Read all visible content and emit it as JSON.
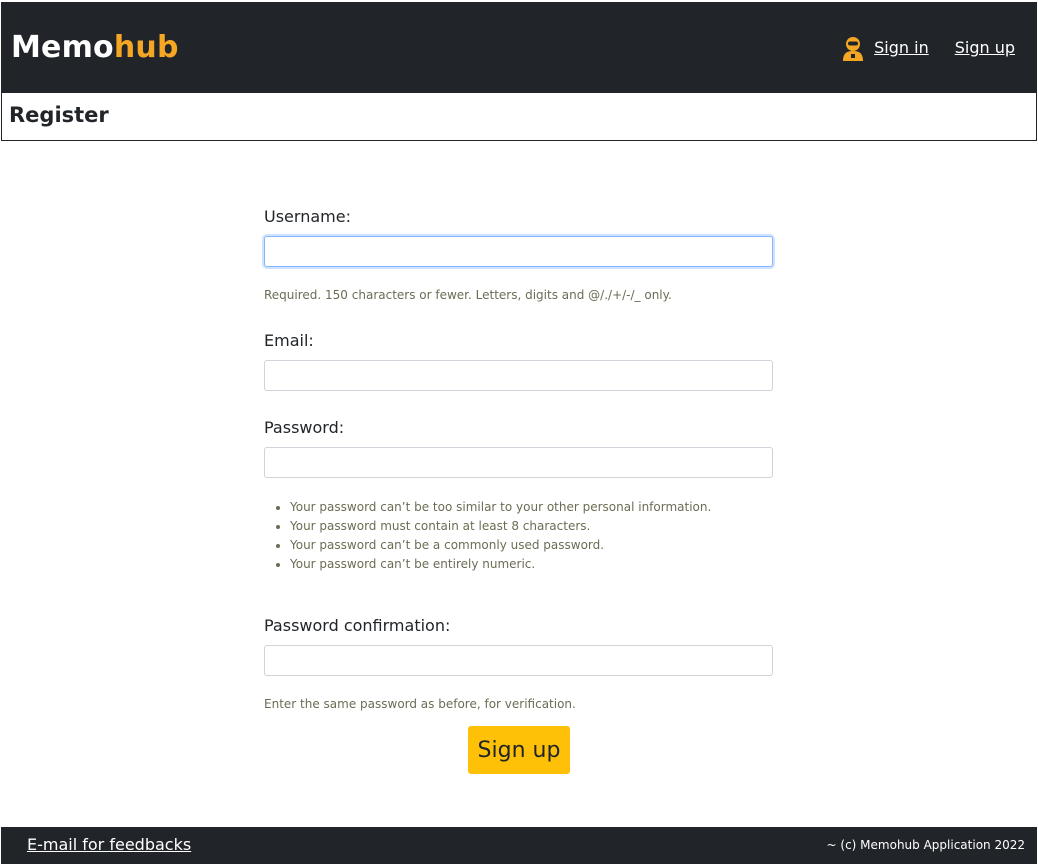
{
  "brand": {
    "part1": "Memo",
    "part2": "hub"
  },
  "nav": {
    "user_icon": "user-icon",
    "signin_label": "Sign in",
    "signup_label": "Sign up"
  },
  "page": {
    "title": "Register"
  },
  "form": {
    "username": {
      "label": "Username:",
      "value": "",
      "help": "Required. 150 characters or fewer. Letters, digits and @/./+/-/_ only."
    },
    "email": {
      "label": "Email:",
      "value": ""
    },
    "password": {
      "label": "Password:",
      "value": "",
      "rules": [
        "Your password can’t be too similar to your other personal information.",
        "Your password must contain at least 8 characters.",
        "Your password can’t be a commonly used password.",
        "Your password can’t be entirely numeric."
      ]
    },
    "password_confirm": {
      "label": "Password confirmation:",
      "value": "",
      "help": "Enter the same password as before, for verification."
    },
    "submit_label": "Sign up"
  },
  "footer": {
    "feedback_link": "E-mail for feedbacks",
    "copyright": "~ (c) Memohub Application 2022"
  },
  "colors": {
    "navbar_bg": "#212529",
    "brand_accent": "#f5a623",
    "button_bg": "#ffc107"
  }
}
